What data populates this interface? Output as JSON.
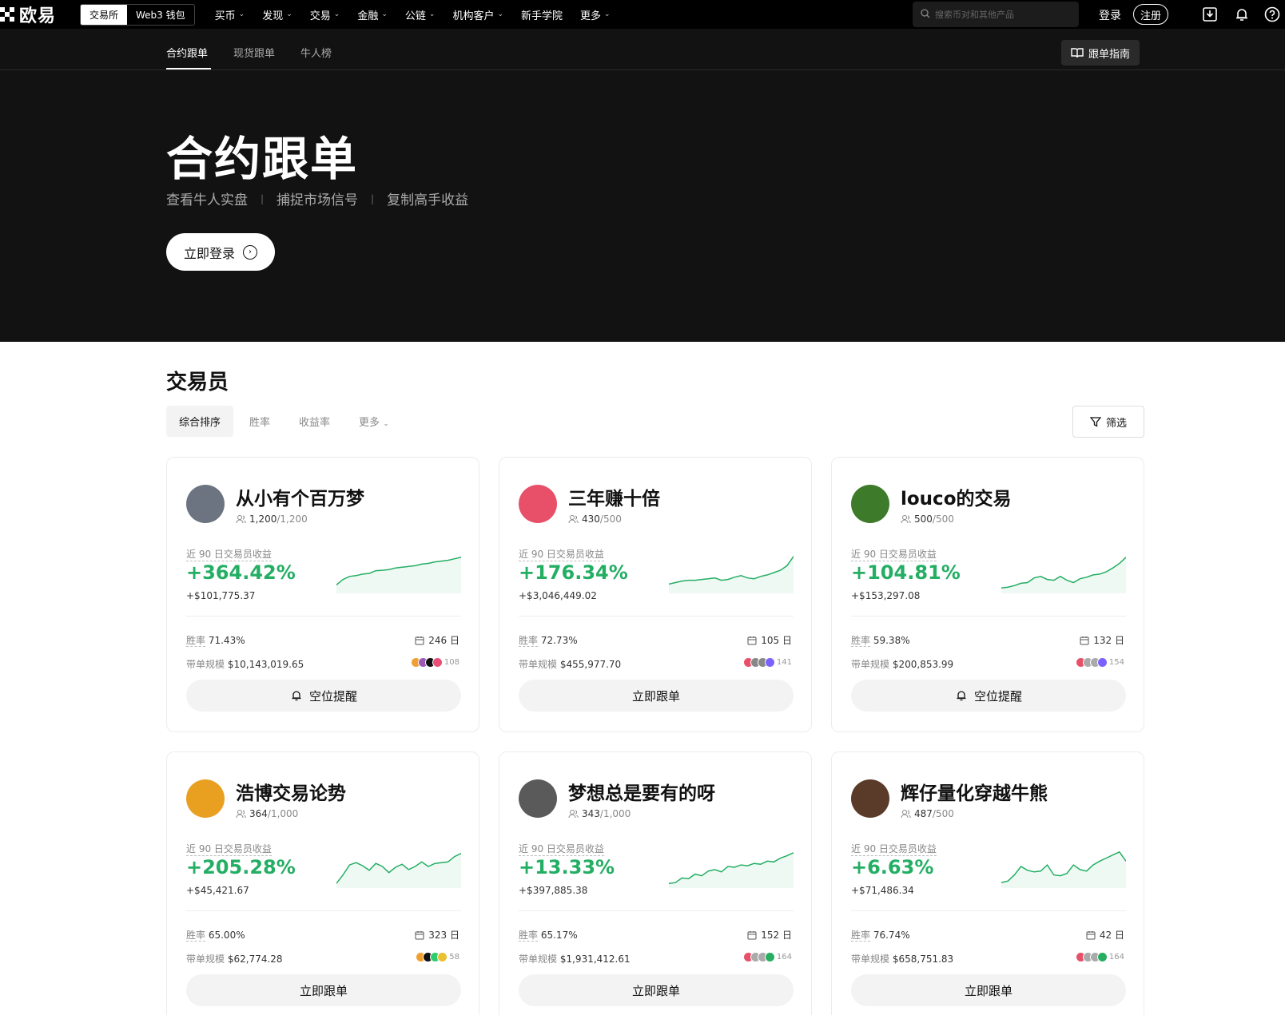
{
  "nav": {
    "logo": "欧易",
    "switch": [
      "交易所",
      "Web3 钱包"
    ],
    "menu": [
      "买币",
      "发现",
      "交易",
      "金融",
      "公链",
      "机构客户",
      "新手学院",
      "更多"
    ],
    "menu_has_chevron": [
      true,
      true,
      true,
      true,
      true,
      true,
      false,
      true
    ],
    "search_placeholder": "搜索币对和其他产品",
    "login": "登录",
    "register": "注册"
  },
  "subnav": {
    "tabs": [
      "合约跟单",
      "现货跟单",
      "牛人榜"
    ],
    "guide": "跟单指南"
  },
  "hero": {
    "title": "合约跟单",
    "taglines": [
      "查看牛人实盘",
      "捕捉市场信号",
      "复制高手收益"
    ],
    "cta": "立即登录"
  },
  "traders": {
    "title": "交易员",
    "sort_tabs": [
      "综合排序",
      "胜率",
      "收益率",
      "更多"
    ],
    "filter": "筛选",
    "roi_label": "近 90 日交易员收益",
    "winrate_label": "胜率",
    "aum_label": "带单规模",
    "days_suffix": "日",
    "cards": [
      {
        "name": "从小有个百万梦",
        "followers": "1,200",
        "max": "/1,200",
        "roi": "+364.42%",
        "pnl": "+$101,775.37",
        "winrate": "71.43%",
        "days": "246",
        "aum": "$10,143,019.65",
        "coin_count": "108",
        "button": "空位提醒",
        "bell": true,
        "avatar": "#6b7480",
        "spark": [
          0.18,
          0.32,
          0.4,
          0.42,
          0.46,
          0.48,
          0.55,
          0.56,
          0.58,
          0.62,
          0.64,
          0.66,
          0.68,
          0.72,
          0.74,
          0.78,
          0.8,
          0.82,
          0.86,
          0.9
        ]
      },
      {
        "name": "三年赚十倍",
        "followers": "430",
        "max": "/500",
        "roi": "+176.34%",
        "pnl": "+$3,046,449.02",
        "winrate": "72.73%",
        "days": "105",
        "aum": "$455,977.70",
        "coin_count": "141",
        "button": "立即跟单",
        "bell": false,
        "avatar": "#e8506a",
        "spark": [
          0.2,
          0.24,
          0.28,
          0.3,
          0.3,
          0.32,
          0.34,
          0.36,
          0.3,
          0.32,
          0.38,
          0.42,
          0.36,
          0.34,
          0.4,
          0.44,
          0.5,
          0.56,
          0.68,
          0.92
        ]
      },
      {
        "name": "louco的交易",
        "followers": "500",
        "max": "/500",
        "roi": "+104.81%",
        "pnl": "+$153,297.08",
        "winrate": "59.38%",
        "days": "132",
        "aum": "$200,853.99",
        "coin_count": "154",
        "button": "空位提醒",
        "bell": true,
        "avatar": "#3d7a2a",
        "spark": [
          0.1,
          0.12,
          0.16,
          0.22,
          0.24,
          0.36,
          0.4,
          0.32,
          0.3,
          0.4,
          0.3,
          0.24,
          0.34,
          0.38,
          0.44,
          0.46,
          0.52,
          0.62,
          0.74,
          0.9
        ]
      },
      {
        "name": "浩博交易论势",
        "followers": "364",
        "max": "/1,000",
        "roi": "+205.28%",
        "pnl": "+$45,421.67",
        "winrate": "65.00%",
        "days": "323",
        "aum": "$62,774.28",
        "coin_count": "58",
        "button": "立即跟单",
        "bell": false,
        "avatar": "#e9a020",
        "spark": [
          0.08,
          0.3,
          0.56,
          0.62,
          0.54,
          0.42,
          0.6,
          0.52,
          0.36,
          0.5,
          0.58,
          0.44,
          0.52,
          0.64,
          0.52,
          0.6,
          0.62,
          0.64,
          0.78,
          0.86
        ]
      },
      {
        "name": "梦想总是要有的呀",
        "followers": "343",
        "max": "/1,000",
        "roi": "+13.33%",
        "pnl": "+$397,885.38",
        "winrate": "65.17%",
        "days": "152",
        "aum": "$1,931,412.61",
        "coin_count": "164",
        "button": "立即跟单",
        "bell": false,
        "avatar": "#5a5a5a",
        "spark": [
          0.08,
          0.1,
          0.22,
          0.2,
          0.32,
          0.28,
          0.4,
          0.44,
          0.38,
          0.52,
          0.5,
          0.56,
          0.54,
          0.6,
          0.58,
          0.66,
          0.64,
          0.74,
          0.8,
          0.88
        ]
      },
      {
        "name": "辉仔量化穿越牛熊",
        "followers": "487",
        "max": "/500",
        "roi": "+6.63%",
        "pnl": "+$71,486.34",
        "winrate": "76.74%",
        "days": "42",
        "aum": "$658,751.83",
        "coin_count": "164",
        "button": "立即跟单",
        "bell": false,
        "avatar": "#5a3a28",
        "spark": [
          0.1,
          0.14,
          0.3,
          0.52,
          0.42,
          0.38,
          0.4,
          0.56,
          0.3,
          0.28,
          0.34,
          0.56,
          0.44,
          0.4,
          0.56,
          0.66,
          0.74,
          0.82,
          0.9,
          0.66
        ]
      }
    ]
  },
  "colors": {
    "accent_green": "#24ae64",
    "loss_red": "#e8506a"
  }
}
